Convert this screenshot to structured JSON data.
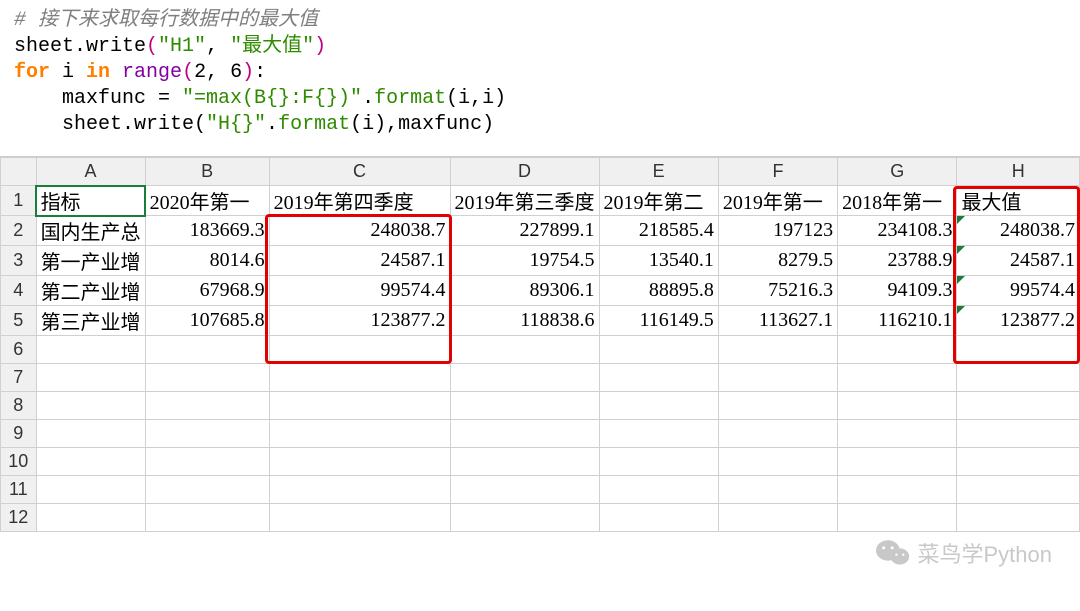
{
  "code": {
    "comment": "# 接下来求取每行数据中的最大值",
    "l1a": "sheet.write",
    "l1b": "\"H1\"",
    "l1c": ", ",
    "l1d": "\"最大值\"",
    "fork": "for",
    "ivar": " i ",
    "inkw": "in",
    "rangew": " range",
    "rargs": "2, 6",
    "l3a": "    maxfunc = ",
    "l3b": "\"=max(B{}:F{})\"",
    "l3c": ".",
    "l3d": "format",
    "l3e": "(i,i)",
    "l4a": "    sheet.write(",
    "l4b": "\"H{}\"",
    "l4c": ".",
    "l4d": "format",
    "l4e": "(i),maxfunc)"
  },
  "columns": [
    "A",
    "B",
    "C",
    "D",
    "E",
    "F",
    "G",
    "H"
  ],
  "rowIndex": [
    "1",
    "2",
    "3",
    "4",
    "5",
    "6",
    "7",
    "8",
    "9",
    "10",
    "11",
    "12"
  ],
  "head": {
    "A": "指标",
    "B": "2020年第一",
    "C": "2019年第四季度",
    "D": "2019年第三季度",
    "E": "2019年第二",
    "F": "2019年第一",
    "G": "2018年第一",
    "H": "最大值"
  },
  "r2": {
    "A": "国内生产总",
    "B": "183669.3",
    "C": "248038.7",
    "D": "227899.1",
    "E": "218585.4",
    "F": "197123",
    "G": "234108.3",
    "H": "248038.7"
  },
  "r3": {
    "A": "第一产业增",
    "B": "8014.6",
    "C": "24587.1",
    "D": "19754.5",
    "E": "13540.1",
    "F": "8279.5",
    "G": "23788.9",
    "H": "24587.1"
  },
  "r4": {
    "A": "第二产业增",
    "B": "67968.9",
    "C": "99574.4",
    "D": "89306.1",
    "E": "88895.8",
    "F": "75216.3",
    "G": "94109.3",
    "H": "99574.4"
  },
  "r5": {
    "A": "第三产业增",
    "B": "107685.8",
    "C": "123877.2",
    "D": "118838.6",
    "E": "116149.5",
    "F": "113627.1",
    "G": "116210.1",
    "H": "123877.2"
  },
  "watermark": "菜鸟学Python",
  "chart_data": {
    "type": "table",
    "title": "",
    "columns": [
      "指标",
      "2020年第一",
      "2019年第四季度",
      "2019年第三季度",
      "2019年第二",
      "2019年第一",
      "2018年第一",
      "最大值"
    ],
    "rows": [
      [
        "国内生产总",
        183669.3,
        248038.7,
        227899.1,
        218585.4,
        197123,
        234108.3,
        248038.7
      ],
      [
        "第一产业增",
        8014.6,
        24587.1,
        19754.5,
        13540.1,
        8279.5,
        23788.9,
        24587.1
      ],
      [
        "第二产业增",
        67968.9,
        99574.4,
        89306.1,
        88895.8,
        75216.3,
        94109.3,
        99574.4
      ],
      [
        "第三产业增",
        107685.8,
        123877.2,
        118838.6,
        116149.5,
        113627.1,
        116210.1,
        123877.2
      ]
    ]
  }
}
